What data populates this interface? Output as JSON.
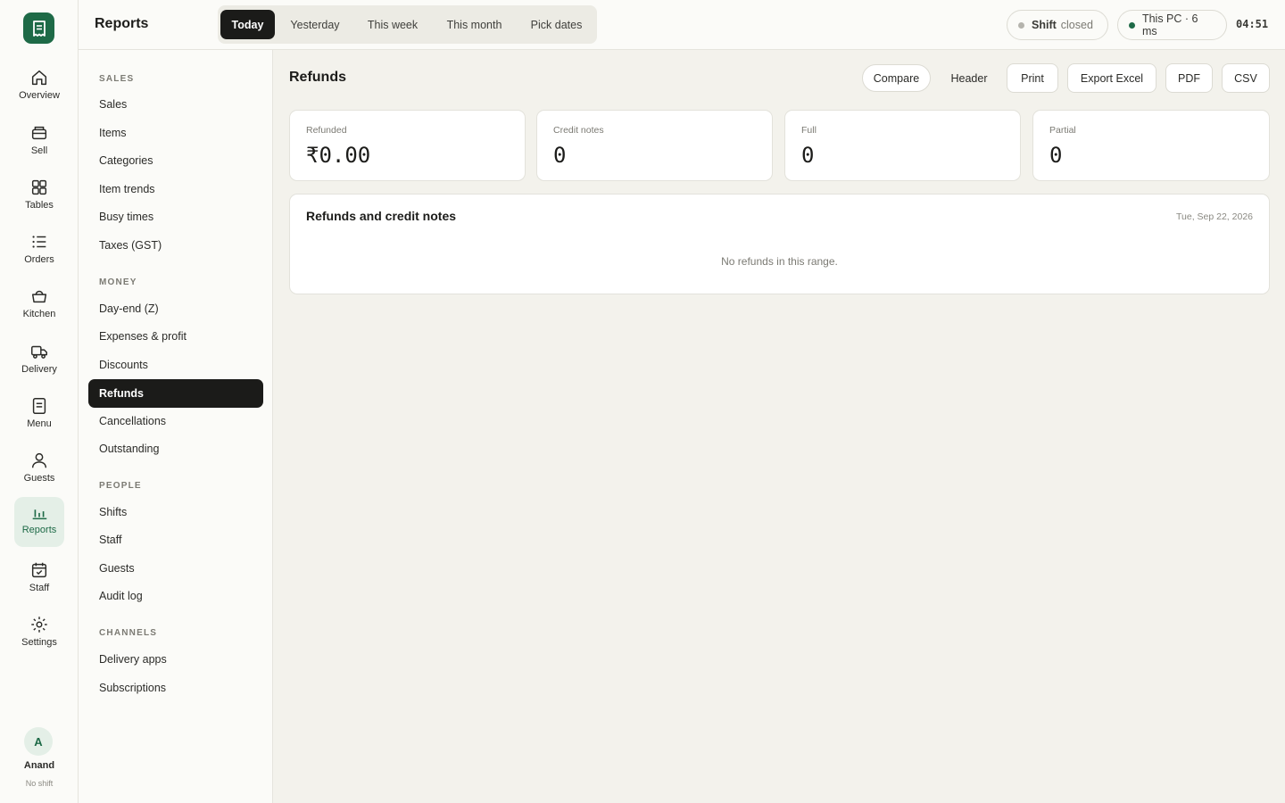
{
  "rail": {
    "items": [
      {
        "label": "Overview",
        "icon": "home-icon"
      },
      {
        "label": "Sell",
        "icon": "register-icon"
      },
      {
        "label": "Tables",
        "icon": "grid-icon"
      },
      {
        "label": "Orders",
        "icon": "list-icon"
      },
      {
        "label": "Kitchen",
        "icon": "basket-icon"
      },
      {
        "label": "Delivery",
        "icon": "truck-icon"
      },
      {
        "label": "Menu",
        "icon": "menu-doc-icon"
      },
      {
        "label": "Guests",
        "icon": "person-icon"
      },
      {
        "label": "Reports",
        "icon": "bar-chart-icon",
        "active": true
      },
      {
        "label": "Staff",
        "icon": "calendar-icon"
      },
      {
        "label": "Settings",
        "icon": "sun-gear-icon"
      }
    ],
    "user": {
      "initial": "A",
      "name": "Anand",
      "status": "No shift"
    }
  },
  "sidebar": {
    "title": "Reports",
    "sections": {
      "sales": "SALES",
      "money": "MONEY",
      "people": "PEOPLE",
      "channels": "CHANNELS"
    },
    "items": {
      "sales": [
        "Sales",
        "Items",
        "Categories",
        "Item trends",
        "Busy times",
        "Taxes (GST)"
      ],
      "money": [
        "Day-end (Z)",
        "Expenses & profit",
        "Discounts",
        "Refunds",
        "Cancellations",
        "Outstanding"
      ],
      "people": [
        "Shifts",
        "Staff",
        "Guests",
        "Audit log"
      ],
      "channels": [
        "Delivery apps",
        "Subscriptions"
      ]
    },
    "active": "Refunds"
  },
  "topbar": {
    "ranges": [
      "Today",
      "Yesterday",
      "This week",
      "This month",
      "Pick dates"
    ],
    "active_range": "Today",
    "shift": {
      "label": "Shift",
      "state": "closed"
    },
    "device": "This PC · 6 ms",
    "clock": "04:51"
  },
  "main": {
    "title": "Refunds",
    "actions": {
      "compare": "Compare",
      "header": "Header",
      "print": "Print",
      "excel": "Export Excel",
      "pdf": "PDF",
      "csv": "CSV"
    },
    "stats": [
      {
        "label": "Refunded",
        "value": "₹0.00"
      },
      {
        "label": "Credit notes",
        "value": "0"
      },
      {
        "label": "Full",
        "value": "0"
      },
      {
        "label": "Partial",
        "value": "0"
      }
    ],
    "panel": {
      "title": "Refunds and credit notes",
      "date": "Tue, Sep 22, 2026",
      "empty": "No refunds in this range."
    }
  },
  "colors": {
    "brand": "#1e6a47",
    "active_bg": "#1b1b19",
    "rail_active_bg": "#e4efe7",
    "page_bg": "#f3f2ec"
  }
}
